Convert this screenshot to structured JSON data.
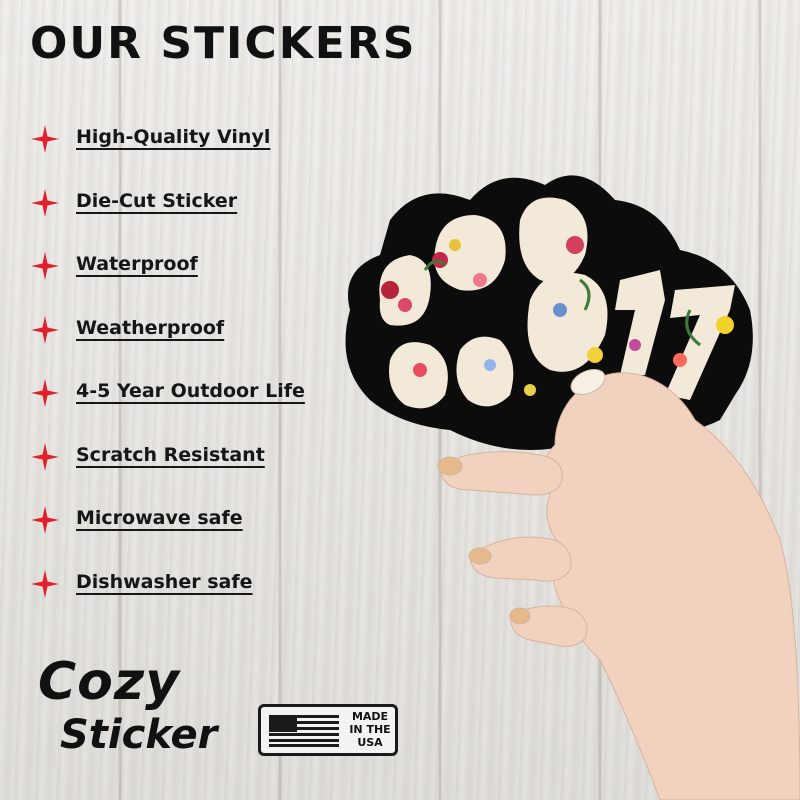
{
  "header": {
    "title": "OUR STICKERS"
  },
  "features": [
    "High-Quality Vinyl",
    "Die-Cut Sticker",
    "Waterproof",
    "Weatherproof",
    "4-5 Year Outdoor Life",
    "Scratch Resistant",
    "Microwave safe",
    "Dishwasher safe"
  ],
  "brand": {
    "line1": "Cozy",
    "line2": "Sticker"
  },
  "badge": {
    "line1": "MADE",
    "line2": "IN THE",
    "line3": "USA"
  },
  "colors": {
    "star": "#e0202a",
    "ink": "#111111",
    "sticker_bg": "#f2e9d8",
    "sticker_outline": "#0c0c0c"
  },
  "icons": {
    "bullet": "red-star-icon",
    "flag": "us-flag-icon"
  }
}
